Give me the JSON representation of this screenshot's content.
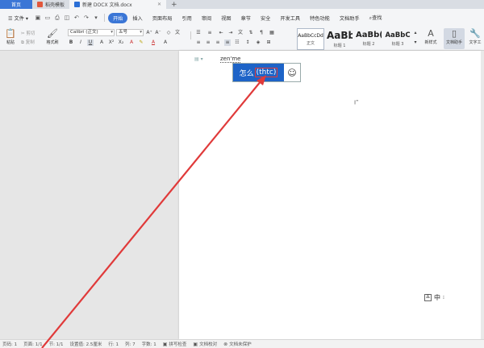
{
  "tabs": [
    {
      "label": "首页",
      "kind": "home"
    },
    {
      "label": "稻壳模板",
      "kind": "app",
      "icon": "daoke-logo-icon"
    },
    {
      "label": "新建 DOCX 文档.docx",
      "kind": "doc",
      "icon": "word-doc-icon"
    }
  ],
  "menu": {
    "file": "文件",
    "items": [
      "开始",
      "插入",
      "页面布局",
      "引用",
      "审阅",
      "视图",
      "章节",
      "安全",
      "开发工具",
      "特色功能",
      "文档助手"
    ],
    "active": "开始",
    "search": "查找"
  },
  "ribbon": {
    "paste": "粘贴",
    "cut": "剪切",
    "copy": "复制",
    "format_painter": "格式刷",
    "font_name": "Calibri (正文)",
    "font_size": "五号",
    "styles": [
      {
        "sample": "AaBbCcDd",
        "label": "正文",
        "selected": true
      },
      {
        "sample": "AaBb",
        "label": "标题 1"
      },
      {
        "sample": "AaBb(",
        "label": "标题 2"
      },
      {
        "sample": "AaBbC",
        "label": "标题 3"
      }
    ],
    "new_style": "新样式",
    "doc_assistant": "文档助手",
    "text_tools": "文字工"
  },
  "doc": {
    "input_pinyin": "zen'me",
    "ime_candidate": "怎么",
    "ime_candidate_hint": "(thtc)",
    "ime_emoji": "☺",
    "cursor_mark": "I",
    "ime_mode_box": "五",
    "ime_mode_lang": "中"
  },
  "status": {
    "page_no": "页码: 1",
    "pages": "页面: 1/1",
    "section": "节: 1/1",
    "settings": "设置值: 2.5厘米",
    "line": "行: 1",
    "col": "列: 7",
    "words": "字数: 1",
    "spell": "拼写检查",
    "proof": "文档校对",
    "protect": "文档未保护"
  },
  "colors": {
    "accent": "#3b76d6",
    "candidate_bg": "#1d63c7",
    "annotation_red": "#e03a3a"
  }
}
